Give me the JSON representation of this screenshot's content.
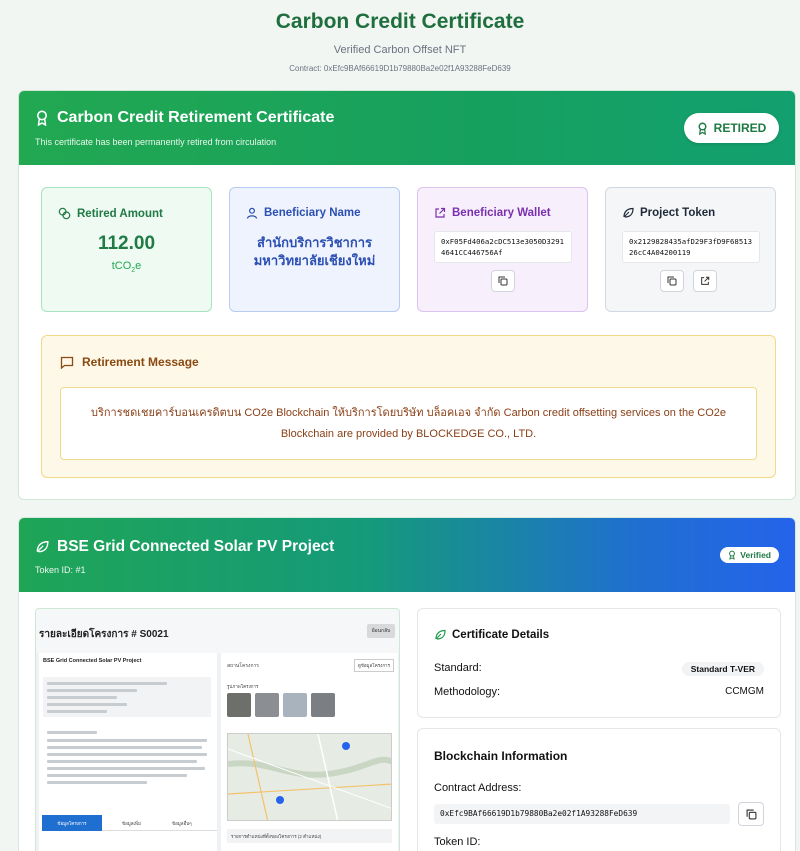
{
  "header": {
    "title": "Carbon Credit Certificate",
    "subtitle": "Verified Carbon Offset NFT",
    "contract": "Contract: 0xEfc9BAf66619D1b79880Ba2e02f1A93288FeD639"
  },
  "retirement": {
    "title": "Carbon Credit Retirement Certificate",
    "description": "This certificate has been permanently retired from circulation",
    "status": "RETIRED",
    "amount_label": "Retired Amount",
    "amount": "112.00",
    "unit_main": "tCO",
    "unit_sub": "2",
    "unit_tail": "e",
    "beneficiary_label": "Beneficiary Name",
    "beneficiary_name": "สำนักบริการวิชาการ มหาวิทยาลัยเชียงใหม่",
    "wallet_label": "Beneficiary Wallet",
    "wallet": "0xF05Fd406a2cDC513e3050D32914641CC446756Af",
    "token_label": "Project Token",
    "token": "0x2129828435afD29F3fD9F6851326cC4A04200119",
    "message_label": "Retirement Message",
    "message": "บริการชดเชยคาร์บอนเครดิตบน CO2e Blockchain ให้บริการโดยบริษัท บล็อคเอจ จำกัด Carbon credit offsetting services on the CO2e Blockchain are provided by BLOCKEDGE CO., LTD."
  },
  "project": {
    "title": "BSE Grid Connected Solar PV Project",
    "token_id": "Token ID: #1",
    "badge": "Verified",
    "screenshot": {
      "title": "รายละเอียดโครงการ # S0021",
      "back": "ย้อนกลับ",
      "left_heading": "BSE Grid Connected Solar PV Project",
      "tab_active": "ข้อมูลโครงการ",
      "tab_2": "ข้อมูลเพิ่ม",
      "tab_3": "ข้อมูลอื่นๆ",
      "right_heading": "สถานโครงการ",
      "right_btn": "ดูข้อมูลโครงการ",
      "photos_label": "รูปภาพโครงการ",
      "map_caption": "รายการตำแหน่งที่ตั้งของโครงการ (2 ตำแหน่ง)"
    }
  },
  "details": {
    "heading": "Certificate Details",
    "standard_label": "Standard:",
    "standard_value": "Standard T-VER",
    "methodology_label": "Methodology:",
    "methodology_value": "CCMGM"
  },
  "blockchain": {
    "heading": "Blockchain Information",
    "contract_label": "Contract Address:",
    "contract_value": "0xEfc9BAf66619D1b79880Ba2e02f1A93288FeD639",
    "token_label": "Token ID:"
  }
}
